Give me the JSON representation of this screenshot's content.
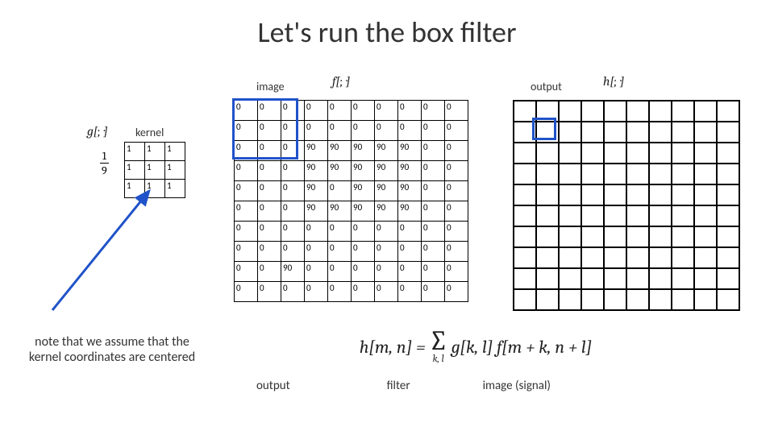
{
  "title": "Let's run the box filter",
  "labels": {
    "kernel": "kernel",
    "image": "image",
    "output": "output"
  },
  "math": {
    "g": "g[·, ·]",
    "f": "f[·, ·]",
    "h": "h[·, ·]"
  },
  "fraction": {
    "num": "1",
    "den": "9"
  },
  "note": "note that we assume that the kernel coordinates are centered",
  "formula": {
    "lhs": "h[m, n] =",
    "sigma_sub": "k, l",
    "rhs": "g[k, l] f[m + k, n + l]",
    "labels": {
      "output": "output",
      "filter": "filter",
      "image": "image (signal)"
    }
  },
  "chart_data": {
    "type": "table",
    "kernel": [
      [
        1,
        1,
        1
      ],
      [
        1,
        1,
        1
      ],
      [
        1,
        1,
        1
      ]
    ],
    "image_grid": [
      [
        0,
        0,
        0,
        0,
        0,
        0,
        0,
        0,
        0,
        0
      ],
      [
        0,
        0,
        0,
        0,
        0,
        0,
        0,
        0,
        0,
        0
      ],
      [
        0,
        0,
        0,
        90,
        90,
        90,
        90,
        90,
        0,
        0
      ],
      [
        0,
        0,
        0,
        90,
        90,
        90,
        90,
        90,
        0,
        0
      ],
      [
        0,
        0,
        0,
        90,
        0,
        90,
        90,
        90,
        0,
        0
      ],
      [
        0,
        0,
        0,
        90,
        90,
        90,
        90,
        90,
        0,
        0
      ],
      [
        0,
        0,
        0,
        0,
        0,
        0,
        0,
        0,
        0,
        0
      ],
      [
        0,
        0,
        0,
        0,
        0,
        0,
        0,
        0,
        0,
        0
      ],
      [
        0,
        0,
        90,
        0,
        0,
        0,
        0,
        0,
        0,
        0
      ],
      [
        0,
        0,
        0,
        0,
        0,
        0,
        0,
        0,
        0,
        0
      ]
    ],
    "output_grid_size": [
      10,
      10
    ]
  }
}
